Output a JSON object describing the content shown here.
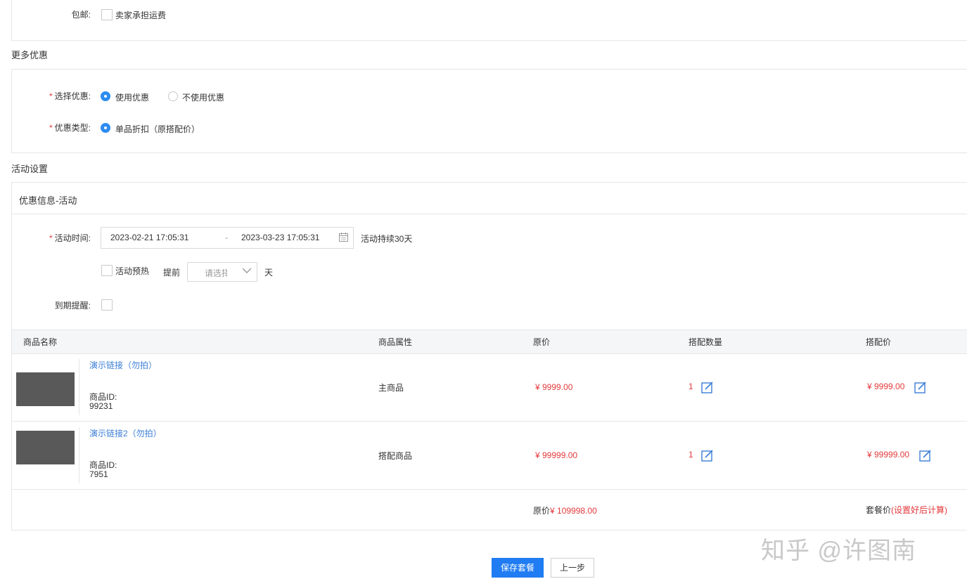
{
  "shipping": {
    "label": "包邮:",
    "option": "卖家承担运费"
  },
  "more_discount": {
    "title": "更多优惠",
    "select_label": "选择优惠:",
    "use_option": "使用优惠",
    "no_use_option": "不使用优惠",
    "type_label": "优惠类型:",
    "type_option": "单品折扣（原搭配价）"
  },
  "activity": {
    "title": "活动设置",
    "panel_title": "优惠信息-活动",
    "time_label": "活动时间:",
    "start": "2023-02-21 17:05:31",
    "separator": "-",
    "end": "2023-03-23 17:05:31",
    "duration": "活动持续30天",
    "preheat_label": "活动预热",
    "advance_label": "提前",
    "select_placeholder": "请选择",
    "day_unit": "天",
    "reminder_label": "到期提醒:"
  },
  "table": {
    "headers": [
      "商品名称",
      "商品属性",
      "原价",
      "搭配数量",
      "搭配价"
    ],
    "rows": [
      {
        "name": "演示链接（勿拍）",
        "id_label": "商品ID:",
        "id": "99231",
        "attr": "主商品",
        "price": "¥ 9999.00",
        "qty": "1",
        "combo_price": "¥ 9999.00"
      },
      {
        "name": "演示链接2（勿拍）",
        "id_label": "商品ID:",
        "id": "7951",
        "attr": "搭配商品",
        "price": "¥ 99999.00",
        "qty": "1",
        "combo_price": "¥ 99999.00"
      }
    ],
    "footer": {
      "orig_label": "原价",
      "orig_value": "¥ 109998.00",
      "package_label": "套餐价",
      "package_note": "(设置好后计算)"
    }
  },
  "buttons": {
    "save": "保存套餐",
    "prev": "上一步"
  },
  "watermark": "知乎 @许图南",
  "colors": {
    "accent": "#2d8cf0",
    "price_red": "#e4393c",
    "link_blue": "#3b7ed6"
  }
}
